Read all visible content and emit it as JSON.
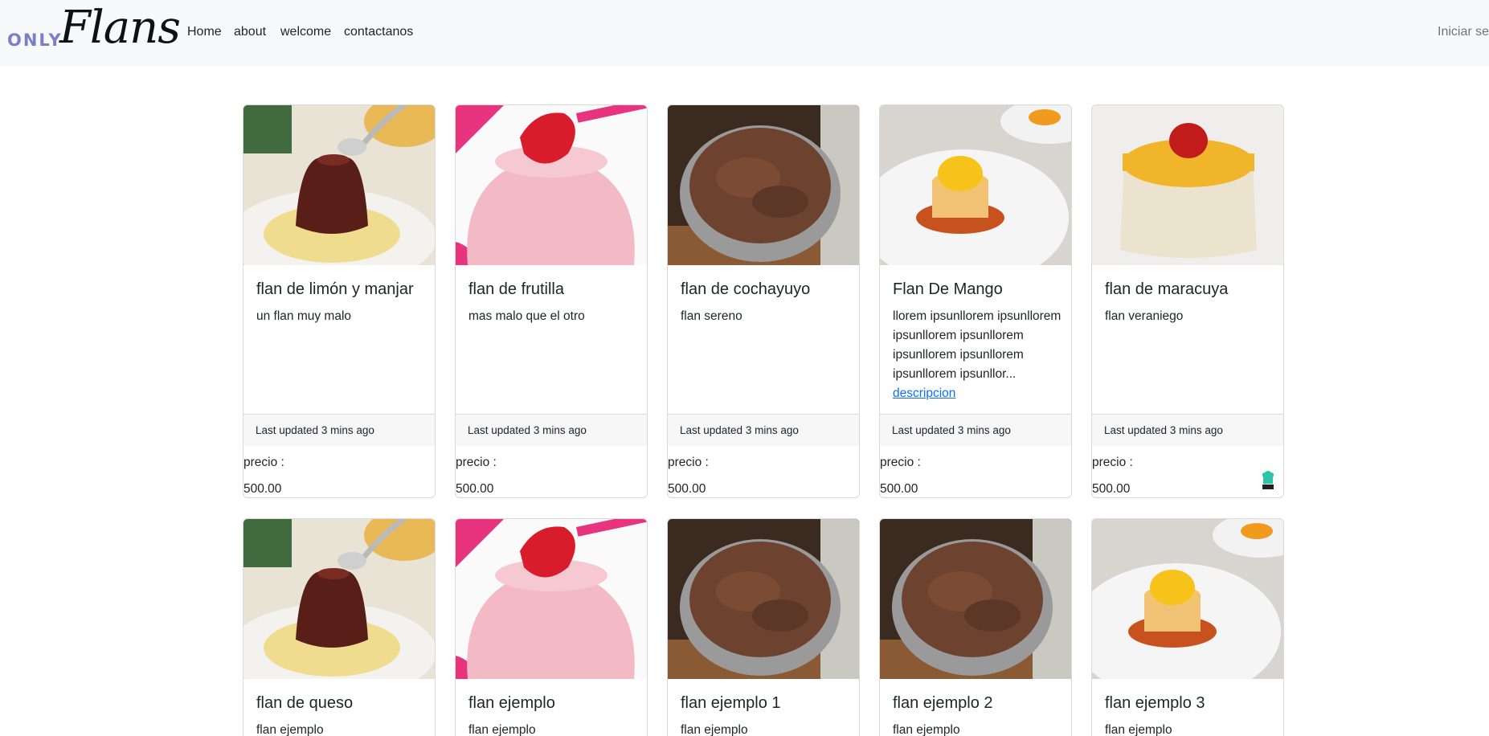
{
  "brand": {
    "prefix": "ONLY",
    "name": "Flans"
  },
  "nav": {
    "links": [
      "Home",
      "about",
      "welcome",
      "contactanos"
    ],
    "login": "Iniciar ses"
  },
  "cards": [
    {
      "title": "flan de limón y manjar",
      "text": "un flan muy malo",
      "footer": "Last updated 3 mins ago",
      "price_label": "precio :",
      "price": "500.00",
      "image": "flan-caramel-image"
    },
    {
      "title": "flan de frutilla",
      "text": "mas malo que el otro",
      "footer": "Last updated 3 mins ago",
      "price_label": "precio :",
      "price": "500.00",
      "image": "strawberry-flan-image"
    },
    {
      "title": "flan de cochayuyo",
      "text": "flan sereno",
      "footer": "Last updated 3 mins ago",
      "price_label": "precio :",
      "price": "500.00",
      "image": "cochayuyo-pot-image"
    },
    {
      "title": "Flan De Mango",
      "text": "llorem ipsunllorem ipsunllorem ipsunllorem ipsunllorem ipsunllorem ipsunllorem ipsunllorem ipsunllor...",
      "link": "descripcion",
      "footer": "Last updated 3 mins ago",
      "price_label": "precio :",
      "price": "500.00",
      "image": "mango-flan-image"
    },
    {
      "title": "flan de maracuya",
      "text": "flan veraniego",
      "footer": "Last updated 3 mins ago",
      "price_label": "precio :",
      "price": "500.00",
      "image": "maracuya-flan-image"
    },
    {
      "title": "flan de queso",
      "text": "flan ejemplo",
      "image": "flan-caramel-image"
    },
    {
      "title": "flan ejemplo",
      "text": "flan ejemplo",
      "image": "strawberry-flan-image"
    },
    {
      "title": "flan ejemplo 1",
      "text": "flan ejemplo",
      "image": "cochayuyo-pot-image"
    },
    {
      "title": "flan ejemplo 2",
      "text": "flan ejemplo",
      "image": "cochayuyo-pot-image"
    },
    {
      "title": "flan ejemplo 3",
      "text": "flan ejemplo",
      "image": "mango-flan-image"
    }
  ],
  "colors": {
    "link": "#0d6efd",
    "navbar_bg": "#f8f9fa",
    "brand_prefix": "#7b7fc9"
  }
}
